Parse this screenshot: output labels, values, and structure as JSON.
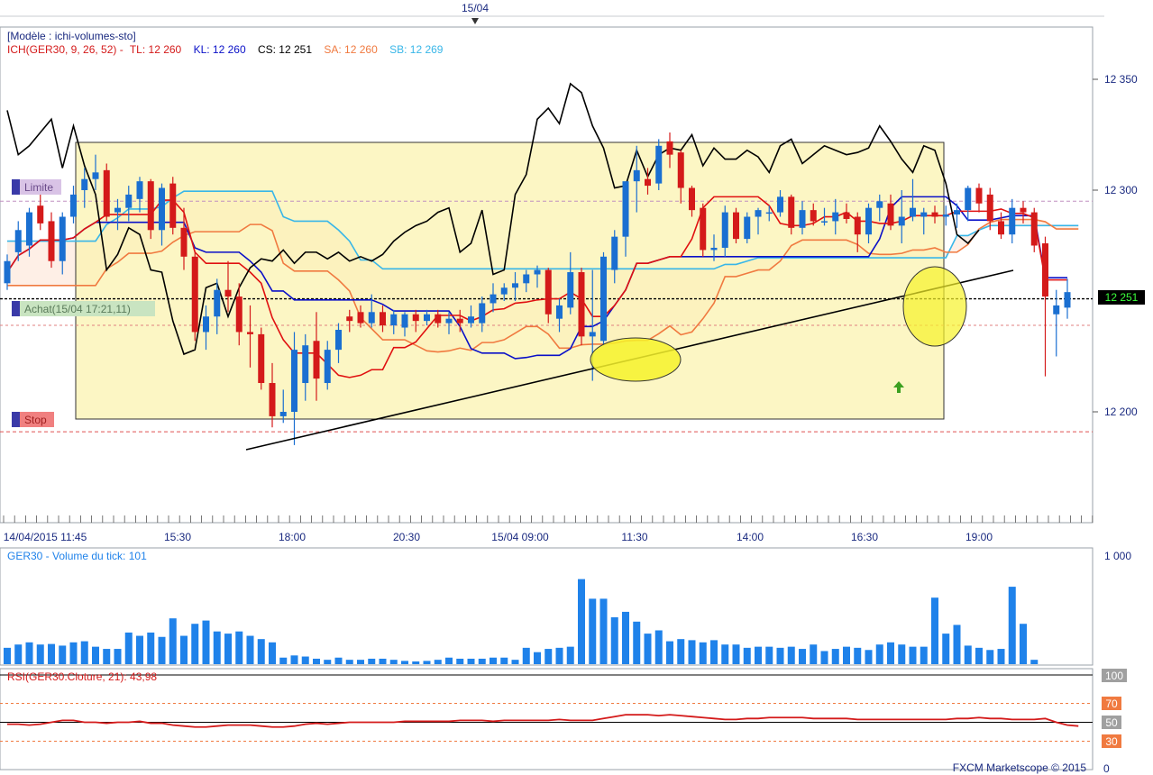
{
  "top_date_label": "15/04",
  "main_panel": {
    "template_label": "[Modèle : ichi-volumes-sto]",
    "legend": {
      "prefix": "ICH(GER30, 9, 26, 52) - ",
      "tl": "TL: 12 260",
      "kl": "KL: 12 260",
      "cs": "CS: 12 251",
      "sa": "SA: 12 260",
      "sb": "SB: 12 269"
    },
    "price_ticks": [
      {
        "value": 12350,
        "label": "12 350"
      },
      {
        "value": 12300,
        "label": "12 300"
      },
      {
        "value": 12200,
        "label": "12 200"
      }
    ],
    "current_price": {
      "value": 12251,
      "label": "12 251"
    },
    "order_labels": {
      "limit": "Limite",
      "buy": "Achat(15/04 17:21,11)",
      "stop": "Stop"
    },
    "order_levels": {
      "limit": 12295,
      "buy": 12251,
      "stop": 12191
    },
    "x_labels": [
      "14/04/2015 11:45",
      "15:30",
      "18:00",
      "20:30",
      "15/04 09:00",
      "11:30",
      "14:00",
      "16:30",
      "19:00"
    ]
  },
  "volume_panel": {
    "label": "GER30 - Volume du tick: 101",
    "tick_label": "1 000",
    "max": 1000
  },
  "rsi_panel": {
    "label": "RSI(GER30.Cloture, 21): 43,98",
    "levels": [
      "100",
      "70",
      "50",
      "30",
      "0"
    ]
  },
  "footer": "FXCM Marketscope © 2015",
  "colors": {
    "bull": "#1a6fd1",
    "bear": "#d41a1a",
    "tenkan": "#e01010",
    "kijun": "#0a10c8",
    "chikou": "#000000",
    "spanA": "#f07a40",
    "spanB": "#38b6e8",
    "box_fill": "#fbf3b0",
    "volume": "#1f82ea",
    "rsi": "#d41a1a"
  },
  "chart_data": {
    "type": "candlestick",
    "title": "ICH(GER30, 9, 26, 52)",
    "price_range": [
      12160,
      12380
    ],
    "candles": [
      {
        "o": 12258,
        "h": 12271,
        "l": 12255,
        "c": 12268
      },
      {
        "o": 12272,
        "h": 12286,
        "l": 12268,
        "c": 12282
      },
      {
        "o": 12275,
        "h": 12292,
        "l": 12270,
        "c": 12290
      },
      {
        "o": 12293,
        "h": 12300,
        "l": 12282,
        "c": 12285
      },
      {
        "o": 12286,
        "h": 12290,
        "l": 12265,
        "c": 12268
      },
      {
        "o": 12268,
        "h": 12290,
        "l": 12262,
        "c": 12288
      },
      {
        "o": 12288,
        "h": 12302,
        "l": 12285,
        "c": 12298
      },
      {
        "o": 12300,
        "h": 12310,
        "l": 12292,
        "c": 12305
      },
      {
        "o": 12305,
        "h": 12316,
        "l": 12300,
        "c": 12308
      },
      {
        "o": 12309,
        "h": 12312,
        "l": 12286,
        "c": 12288
      },
      {
        "o": 12290,
        "h": 12296,
        "l": 12282,
        "c": 12292
      },
      {
        "o": 12292,
        "h": 12302,
        "l": 12286,
        "c": 12298
      },
      {
        "o": 12296,
        "h": 12306,
        "l": 12290,
        "c": 12304
      },
      {
        "o": 12304,
        "h": 12305,
        "l": 12278,
        "c": 12282
      },
      {
        "o": 12282,
        "h": 12303,
        "l": 12275,
        "c": 12301
      },
      {
        "o": 12303,
        "h": 12306,
        "l": 12280,
        "c": 12283
      },
      {
        "o": 12283,
        "h": 12292,
        "l": 12264,
        "c": 12270
      },
      {
        "o": 12270,
        "h": 12272,
        "l": 12232,
        "c": 12236
      },
      {
        "o": 12236,
        "h": 12248,
        "l": 12228,
        "c": 12243
      },
      {
        "o": 12243,
        "h": 12260,
        "l": 12235,
        "c": 12255
      },
      {
        "o": 12255,
        "h": 12268,
        "l": 12245,
        "c": 12252
      },
      {
        "o": 12252,
        "h": 12258,
        "l": 12230,
        "c": 12236
      },
      {
        "o": 12236,
        "h": 12248,
        "l": 12220,
        "c": 12235
      },
      {
        "o": 12235,
        "h": 12238,
        "l": 12210,
        "c": 12213
      },
      {
        "o": 12213,
        "h": 12222,
        "l": 12193,
        "c": 12198
      },
      {
        "o": 12198,
        "h": 12210,
        "l": 12195,
        "c": 12200
      },
      {
        "o": 12200,
        "h": 12236,
        "l": 12185,
        "c": 12228
      },
      {
        "o": 12213,
        "h": 12235,
        "l": 12205,
        "c": 12230
      },
      {
        "o": 12232,
        "h": 12245,
        "l": 12205,
        "c": 12215
      },
      {
        "o": 12213,
        "h": 12232,
        "l": 12210,
        "c": 12228
      },
      {
        "o": 12228,
        "h": 12240,
        "l": 12222,
        "c": 12237
      },
      {
        "o": 12243,
        "h": 12246,
        "l": 12236,
        "c": 12241
      },
      {
        "o": 12245,
        "h": 12248,
        "l": 12238,
        "c": 12240
      },
      {
        "o": 12240,
        "h": 12253,
        "l": 12238,
        "c": 12245
      },
      {
        "o": 12245,
        "h": 12248,
        "l": 12236,
        "c": 12239
      },
      {
        "o": 12239,
        "h": 12246,
        "l": 12235,
        "c": 12244
      },
      {
        "o": 12238,
        "h": 12245,
        "l": 12234,
        "c": 12244
      },
      {
        "o": 12244,
        "h": 12246,
        "l": 12236,
        "c": 12241
      },
      {
        "o": 12241,
        "h": 12246,
        "l": 12239,
        "c": 12244
      },
      {
        "o": 12244,
        "h": 12246,
        "l": 12238,
        "c": 12240
      },
      {
        "o": 12240,
        "h": 12245,
        "l": 12235,
        "c": 12242
      },
      {
        "o": 12242,
        "h": 12246,
        "l": 12236,
        "c": 12240
      },
      {
        "o": 12240,
        "h": 12248,
        "l": 12238,
        "c": 12243
      },
      {
        "o": 12240,
        "h": 12252,
        "l": 12236,
        "c": 12249
      },
      {
        "o": 12249,
        "h": 12258,
        "l": 12245,
        "c": 12253
      },
      {
        "o": 12253,
        "h": 12258,
        "l": 12250,
        "c": 12256
      },
      {
        "o": 12256,
        "h": 12263,
        "l": 12250,
        "c": 12258
      },
      {
        "o": 12258,
        "h": 12264,
        "l": 12254,
        "c": 12262
      },
      {
        "o": 12262,
        "h": 12266,
        "l": 12256,
        "c": 12264
      },
      {
        "o": 12264,
        "h": 12265,
        "l": 12240,
        "c": 12244
      },
      {
        "o": 12242,
        "h": 12251,
        "l": 12236,
        "c": 12248
      },
      {
        "o": 12247,
        "h": 12272,
        "l": 12244,
        "c": 12263
      },
      {
        "o": 12263,
        "h": 12265,
        "l": 12230,
        "c": 12234
      },
      {
        "o": 12234,
        "h": 12264,
        "l": 12214,
        "c": 12236
      },
      {
        "o": 12232,
        "h": 12272,
        "l": 12230,
        "c": 12270
      },
      {
        "o": 12264,
        "h": 12282,
        "l": 12258,
        "c": 12279
      },
      {
        "o": 12279,
        "h": 12296,
        "l": 12270,
        "c": 12304
      },
      {
        "o": 12304,
        "h": 12320,
        "l": 12290,
        "c": 12309
      },
      {
        "o": 12305,
        "h": 12310,
        "l": 12298,
        "c": 12302
      },
      {
        "o": 12303,
        "h": 12323,
        "l": 12300,
        "c": 12320
      },
      {
        "o": 12322,
        "h": 12326,
        "l": 12310,
        "c": 12316
      },
      {
        "o": 12317,
        "h": 12318,
        "l": 12294,
        "c": 12301
      },
      {
        "o": 12301,
        "h": 12302,
        "l": 12288,
        "c": 12291
      },
      {
        "o": 12292,
        "h": 12294,
        "l": 12270,
        "c": 12273
      },
      {
        "o": 12273,
        "h": 12280,
        "l": 12268,
        "c": 12274
      },
      {
        "o": 12274,
        "h": 12293,
        "l": 12270,
        "c": 12290
      },
      {
        "o": 12290,
        "h": 12292,
        "l": 12276,
        "c": 12278
      },
      {
        "o": 12278,
        "h": 12290,
        "l": 12276,
        "c": 12288
      },
      {
        "o": 12288,
        "h": 12292,
        "l": 12280,
        "c": 12291
      },
      {
        "o": 12290,
        "h": 12293,
        "l": 12286,
        "c": 12290
      },
      {
        "o": 12290,
        "h": 12300,
        "l": 12288,
        "c": 12297
      },
      {
        "o": 12297,
        "h": 12298,
        "l": 12280,
        "c": 12283
      },
      {
        "o": 12283,
        "h": 12295,
        "l": 12280,
        "c": 12291
      },
      {
        "o": 12291,
        "h": 12294,
        "l": 12284,
        "c": 12286
      },
      {
        "o": 12286,
        "h": 12292,
        "l": 12284,
        "c": 12286
      },
      {
        "o": 12286,
        "h": 12296,
        "l": 12280,
        "c": 12290
      },
      {
        "o": 12290,
        "h": 12294,
        "l": 12285,
        "c": 12287
      },
      {
        "o": 12288,
        "h": 12290,
        "l": 12272,
        "c": 12280
      },
      {
        "o": 12280,
        "h": 12294,
        "l": 12276,
        "c": 12292
      },
      {
        "o": 12292,
        "h": 12298,
        "l": 12286,
        "c": 12295
      },
      {
        "o": 12294,
        "h": 12298,
        "l": 12282,
        "c": 12284
      },
      {
        "o": 12284,
        "h": 12300,
        "l": 12276,
        "c": 12288
      },
      {
        "o": 12288,
        "h": 12305,
        "l": 12286,
        "c": 12292
      },
      {
        "o": 12288,
        "h": 12292,
        "l": 12280,
        "c": 12290
      },
      {
        "o": 12290,
        "h": 12293,
        "l": 12285,
        "c": 12288
      },
      {
        "o": 12288,
        "h": 12293,
        "l": 12284,
        "c": 12289
      },
      {
        "o": 12289,
        "h": 12294,
        "l": 12283,
        "c": 12291
      },
      {
        "o": 12291,
        "h": 12302,
        "l": 12286,
        "c": 12301
      },
      {
        "o": 12301,
        "h": 12303,
        "l": 12290,
        "c": 12294
      },
      {
        "o": 12298,
        "h": 12301,
        "l": 12282,
        "c": 12286
      },
      {
        "o": 12286,
        "h": 12290,
        "l": 12278,
        "c": 12280
      },
      {
        "o": 12280,
        "h": 12296,
        "l": 12276,
        "c": 12292
      },
      {
        "o": 12292,
        "h": 12295,
        "l": 12285,
        "c": 12290
      },
      {
        "o": 12290,
        "h": 12292,
        "l": 12272,
        "c": 12275
      },
      {
        "o": 12276,
        "h": 12279,
        "l": 12216,
        "c": 12252
      },
      {
        "o": 12244,
        "h": 12255,
        "l": 12225,
        "c": 12248
      },
      {
        "o": 12247,
        "h": 12260,
        "l": 12242,
        "c": 12254
      }
    ],
    "volume": [
      150,
      180,
      200,
      180,
      185,
      170,
      200,
      210,
      160,
      140,
      140,
      290,
      260,
      290,
      250,
      420,
      260,
      370,
      400,
      300,
      280,
      300,
      260,
      230,
      200,
      60,
      80,
      70,
      50,
      40,
      60,
      40,
      40,
      50,
      50,
      40,
      30,
      25,
      30,
      40,
      60,
      50,
      50,
      50,
      60,
      60,
      40,
      150,
      110,
      140,
      150,
      160,
      780,
      600,
      600,
      430,
      480,
      390,
      280,
      310,
      210,
      230,
      220,
      200,
      220,
      180,
      180,
      150,
      160,
      160,
      150,
      160,
      140,
      180,
      120,
      140,
      160,
      150,
      130,
      180,
      200,
      180,
      160,
      160,
      610,
      280,
      360,
      170,
      150,
      130,
      140,
      710,
      370,
      40
    ],
    "rsi": [
      48,
      48,
      47,
      48,
      50,
      52,
      52,
      50,
      50,
      49,
      50,
      50,
      51,
      49,
      49,
      47,
      46,
      45,
      45,
      46,
      47,
      47,
      47,
      46,
      45,
      45,
      46,
      48,
      49,
      48,
      49,
      50,
      50,
      50,
      50,
      50,
      51,
      51,
      51,
      51,
      51,
      52,
      52,
      52,
      51,
      52,
      52,
      52,
      52,
      52,
      53,
      52,
      52,
      52,
      54,
      56,
      58,
      58,
      58,
      57,
      58,
      57,
      56,
      55,
      54,
      53,
      53,
      54,
      54,
      55,
      55,
      55,
      55,
      54,
      54,
      54,
      54,
      53,
      53,
      53,
      53,
      53,
      53,
      53,
      53,
      53,
      54,
      54,
      55,
      54,
      54,
      53,
      53,
      53,
      54,
      50,
      47,
      46
    ]
  }
}
